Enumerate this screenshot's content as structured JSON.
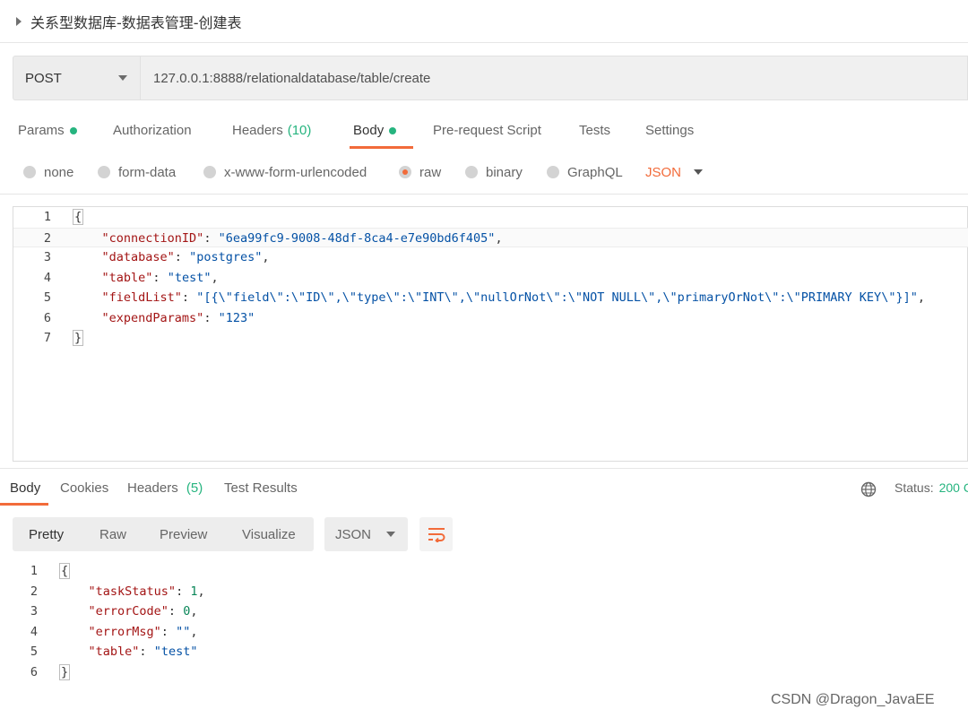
{
  "request": {
    "title": "关系型数据库-数据表管理-创建表",
    "method": "POST",
    "url": "127.0.0.1:8888/relationaldatabase/table/create"
  },
  "req_tabs": {
    "params": "Params",
    "authorization": "Authorization",
    "headers": "Headers",
    "headers_count": "(10)",
    "body": "Body",
    "pre_request": "Pre-request Script",
    "tests": "Tests",
    "settings": "Settings"
  },
  "body_types": {
    "none": "none",
    "form_data": "form-data",
    "urlencoded": "x-www-form-urlencoded",
    "raw": "raw",
    "binary": "binary",
    "graphql": "GraphQL",
    "format": "JSON",
    "selected": "raw"
  },
  "request_body": {
    "line_numbers": [
      "1",
      "2",
      "3",
      "4",
      "5",
      "6",
      "7"
    ],
    "open": "{",
    "close": "}",
    "fields": [
      {
        "key": "\"connectionID\"",
        "value": "\"6ea99fc9-9008-48df-8ca4-e7e90bd6f405\"",
        "trail": ","
      },
      {
        "key": "\"database\"",
        "value": "\"postgres\"",
        "trail": ","
      },
      {
        "key": "\"table\"",
        "value": "\"test\"",
        "trail": ","
      },
      {
        "key": "\"fieldList\"",
        "value": "\"[{\\\"field\\\":\\\"ID\\\",\\\"type\\\":\\\"INT\\\",\\\"nullOrNot\\\":\\\"NOT NULL\\\",\\\"primaryOrNot\\\":\\\"PRIMARY KEY\\\"}]\"",
        "trail": ","
      },
      {
        "key": "\"expendParams\"",
        "value": "\"123\"",
        "trail": ""
      }
    ]
  },
  "resp_tabs": {
    "body": "Body",
    "cookies": "Cookies",
    "headers": "Headers",
    "headers_count": "(5)",
    "test_results": "Test Results",
    "status_label": "Status:",
    "status_value": "200 C"
  },
  "resp_view": {
    "pretty": "Pretty",
    "raw": "Raw",
    "preview": "Preview",
    "visualize": "Visualize",
    "format": "JSON"
  },
  "response_body": {
    "line_numbers": [
      "1",
      "2",
      "3",
      "4",
      "5",
      "6"
    ],
    "open": "{",
    "close": "}",
    "fields": [
      {
        "key": "\"taskStatus\"",
        "value": "1",
        "trail": ",",
        "numeric": true
      },
      {
        "key": "\"errorCode\"",
        "value": "0",
        "trail": ",",
        "numeric": true
      },
      {
        "key": "\"errorMsg\"",
        "value": "\"\"",
        "trail": ",",
        "numeric": false
      },
      {
        "key": "\"table\"",
        "value": "\"test\"",
        "trail": "",
        "numeric": false
      }
    ]
  },
  "watermark": "CSDN @Dragon_JavaEE",
  "colors": {
    "accent": "#f26b3a",
    "success": "#26b47f",
    "key": "#a31515",
    "string": "#0451a5",
    "number": "#098658"
  }
}
